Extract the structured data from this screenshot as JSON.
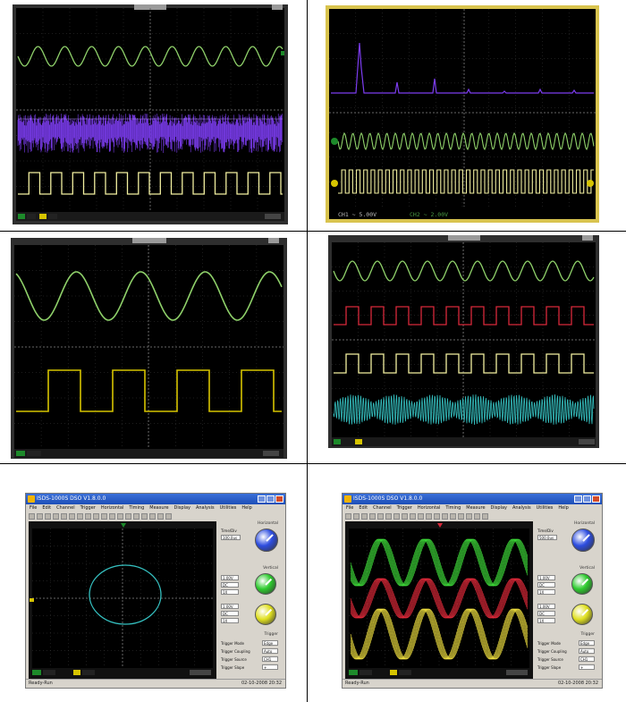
{
  "colors": {
    "screen_bg": "#000000",
    "grid": "#3a3a3a",
    "ch_green": "#8fd16a",
    "ch_purple": "#7c3cf0",
    "ch_yellow": "#f2f0a0",
    "ch_red": "#d8283a",
    "ch_cyan": "#35c0c0",
    "bezel": "#2e2e2e",
    "gold_frame": "#d8c34e"
  },
  "panel_b": {
    "ch1_label": "CH1 ~ 5.00V",
    "ch2_label": "CH2 ~ 2.00V"
  },
  "windows": [
    {
      "id": "xy",
      "title": "ISDS-1000S DSO V1.8.0.0",
      "menu": [
        "File",
        "Edit",
        "Channel",
        "Trigger",
        "Horizontal",
        "Timing",
        "Measure",
        "Display",
        "Analysis",
        "Utilities",
        "Help"
      ],
      "status_left": "Ready-Run",
      "status_right": "02-10-2008  20:32",
      "panel_titles": [
        "Horizontal",
        "Vertical",
        "Trigger"
      ],
      "timebase": "Time/Div",
      "timebase_value": "100.0us",
      "ch_rows": [
        "1.00V",
        "DC",
        "1X"
      ],
      "trigger_rows": [
        [
          "Trigger Mode",
          "Edge"
        ],
        [
          "Trigger Coupling",
          "Auto"
        ],
        [
          "Trigger Source",
          "CH1"
        ],
        [
          "Trigger Slope",
          "+"
        ]
      ]
    },
    {
      "id": "multi",
      "title": "ISDS-1000S DSO V1.8.0.0",
      "menu": [
        "File",
        "Edit",
        "Channel",
        "Trigger",
        "Horizontal",
        "Timing",
        "Measure",
        "Display",
        "Analysis",
        "Utilities",
        "Help"
      ],
      "status_left": "Ready-Run",
      "status_right": "02-10-2008  20:32",
      "panel_titles": [
        "Horizontal",
        "Vertical",
        "Trigger"
      ],
      "timebase": "Time/Div",
      "timebase_value": "500.0us",
      "ch_rows": [
        "1.00V",
        "DC",
        "1X"
      ],
      "trigger_rows": [
        [
          "Trigger Mode",
          "Edge"
        ],
        [
          "Trigger Coupling",
          "Auto"
        ],
        [
          "Trigger Source",
          "CH1"
        ],
        [
          "Trigger Slope",
          "+"
        ]
      ]
    }
  ]
}
